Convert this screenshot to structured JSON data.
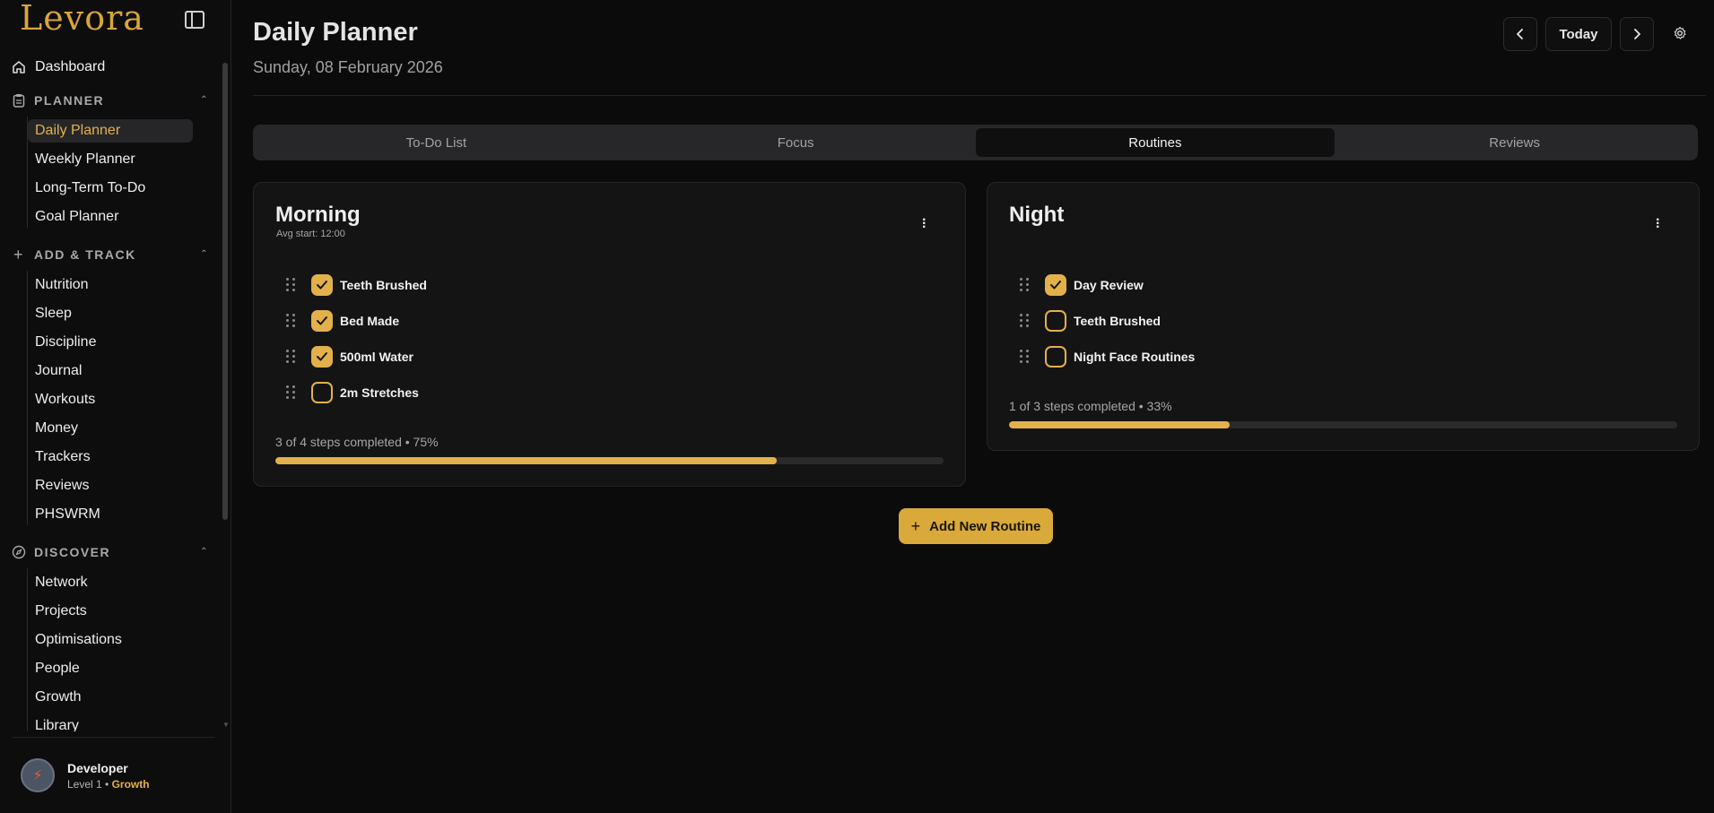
{
  "app": {
    "logo": "Levora"
  },
  "sidebar": {
    "dashboard_label": "Dashboard",
    "sections": [
      {
        "title": "PLANNER",
        "items": [
          "Daily Planner",
          "Weekly Planner",
          "Long-Term To-Do",
          "Goal Planner"
        ],
        "active": "Daily Planner"
      },
      {
        "title": "ADD & TRACK",
        "items": [
          "Nutrition",
          "Sleep",
          "Discipline",
          "Journal",
          "Workouts",
          "Money",
          "Trackers",
          "Reviews",
          "PHSWRM"
        ]
      },
      {
        "title": "DISCOVER",
        "items": [
          "Network",
          "Projects",
          "Optimisations",
          "People",
          "Growth",
          "Library"
        ]
      }
    ],
    "user": {
      "name": "Developer",
      "level": "Level 1",
      "separator": "•",
      "tier": "Growth"
    }
  },
  "header": {
    "title": "Daily Planner",
    "date": "Sunday, 08 February 2026",
    "today_label": "Today",
    "prev_icon": "chevron-left-icon",
    "next_icon": "chevron-right-icon",
    "settings_icon": "gear-icon"
  },
  "tabs": [
    "To-Do List",
    "Focus",
    "Routines",
    "Reviews"
  ],
  "active_tab": "Routines",
  "routines": [
    {
      "title": "Morning",
      "subtitle": "Avg start: 12:00",
      "steps": [
        {
          "label": "Teeth Brushed",
          "done": true
        },
        {
          "label": "Bed Made",
          "done": true
        },
        {
          "label": "500ml Water",
          "done": true
        },
        {
          "label": "2m Stretches",
          "done": false
        }
      ],
      "progress_text": "3 of 4 steps completed • 75%",
      "progress": 0.75
    },
    {
      "title": "Night",
      "subtitle": "",
      "steps": [
        {
          "label": "Day Review",
          "done": true
        },
        {
          "label": "Teeth Brushed",
          "done": false
        },
        {
          "label": "Night Face Routines",
          "done": false
        }
      ],
      "progress_text": "1 of 3 steps completed • 33%",
      "progress": 0.33
    }
  ],
  "add_routine_label": "Add New Routine",
  "colors": {
    "accent": "#e3b14b",
    "background": "#0b0b0c",
    "card": "#141415"
  }
}
